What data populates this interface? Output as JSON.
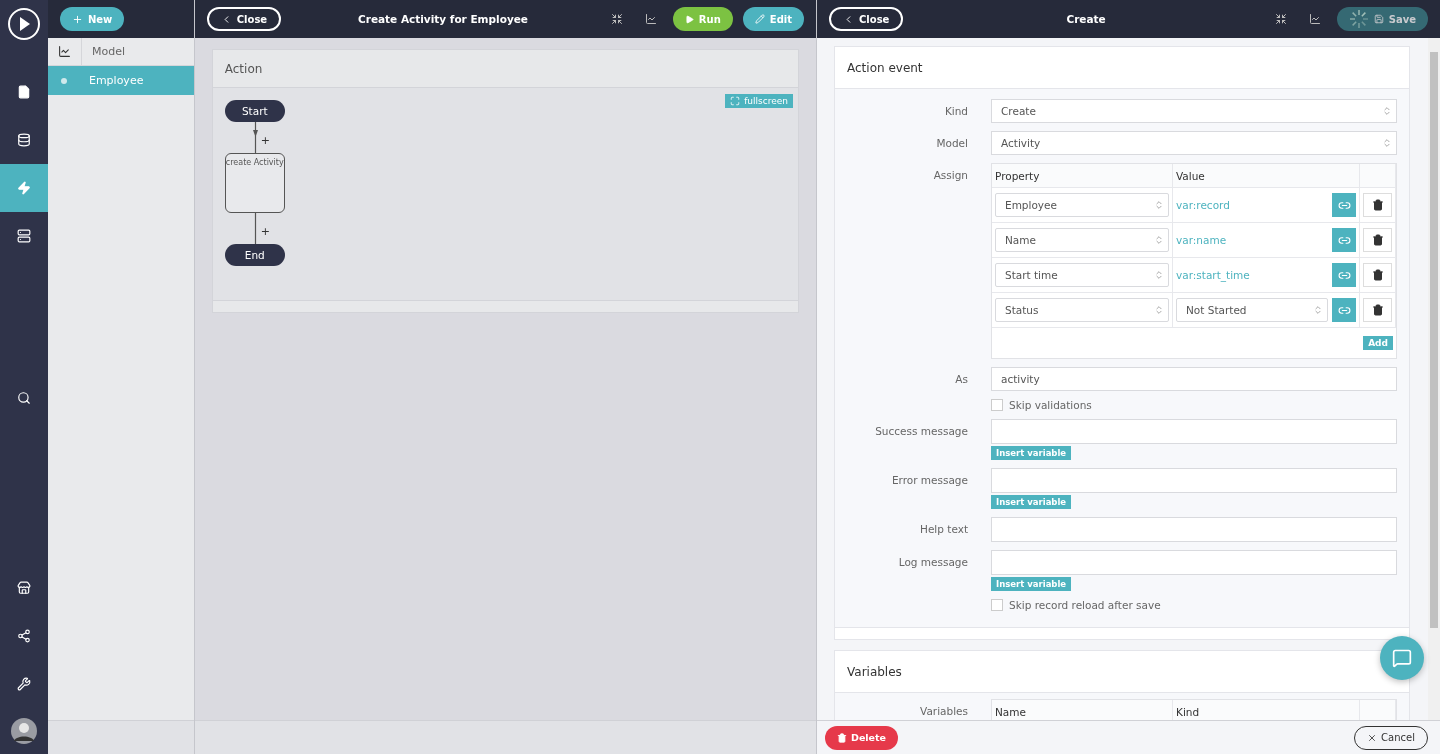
{
  "nav_top": [
    {
      "kind": "document",
      "selected": false
    },
    {
      "kind": "database",
      "selected": false
    },
    {
      "kind": "lightning",
      "selected": true
    },
    {
      "kind": "server",
      "selected": false
    }
  ],
  "nav_middle": [
    {
      "kind": "search",
      "selected": false
    }
  ],
  "nav_bottom": [
    {
      "kind": "store",
      "selected": false
    },
    {
      "kind": "network",
      "selected": false
    },
    {
      "kind": "tools",
      "selected": false
    }
  ],
  "new_button": "New",
  "model_list": {
    "header": "Model",
    "items": [
      {
        "label": "Employee",
        "selected": true
      }
    ]
  },
  "editor": {
    "close": "Close",
    "title": "Create Activity for Employee",
    "run": "Run",
    "edit": "Edit",
    "card": {
      "title": "Action",
      "fullscreen": "fullscreen",
      "nodes": [
        {
          "kind": "terminal",
          "label": "Start"
        },
        {
          "kind": "step",
          "label": "create Activity"
        },
        {
          "kind": "terminal",
          "label": "End"
        }
      ],
      "edges": [
        {
          "label": "+"
        },
        {
          "label": "+"
        }
      ]
    }
  },
  "detail": {
    "close": "Close",
    "title": "Create",
    "save": "Save",
    "saving": true,
    "card": {
      "title": "Action event",
      "fields": [
        {
          "kind": "select",
          "label": "Kind",
          "value": "Create"
        },
        {
          "kind": "select",
          "label": "Model",
          "value": "Activity"
        },
        {
          "kind": "assign",
          "label": "Assign",
          "columns": [
            "Property",
            "Value"
          ],
          "add": "Add",
          "rows": [
            {
              "property": "Employee",
              "value": "var:record",
              "kind": "variable"
            },
            {
              "property": "Name",
              "value": "var:name",
              "kind": "variable"
            },
            {
              "property": "Start time",
              "value": "var:start_time",
              "kind": "variable"
            },
            {
              "property": "Status",
              "value": "Not Started",
              "kind": "select"
            }
          ]
        },
        {
          "kind": "input",
          "label": "As",
          "value": "activity"
        },
        {
          "kind": "checkbox",
          "label": "Skip validations",
          "checked": false
        },
        {
          "kind": "textarea",
          "label": "Success message",
          "insert": "Insert variable"
        },
        {
          "kind": "textarea",
          "label": "Error message",
          "insert": "Insert variable"
        },
        {
          "kind": "textarea",
          "label": "Help text"
        },
        {
          "kind": "textarea",
          "label": "Log message",
          "insert": "Insert variable"
        },
        {
          "kind": "checkbox",
          "label": "Skip record reload after save",
          "checked": false
        }
      ]
    },
    "variables": {
      "title": "Variables",
      "label": "Variables",
      "columns": [
        "Name",
        "Kind"
      ]
    },
    "delete": "Delete",
    "cancel": "Cancel"
  }
}
